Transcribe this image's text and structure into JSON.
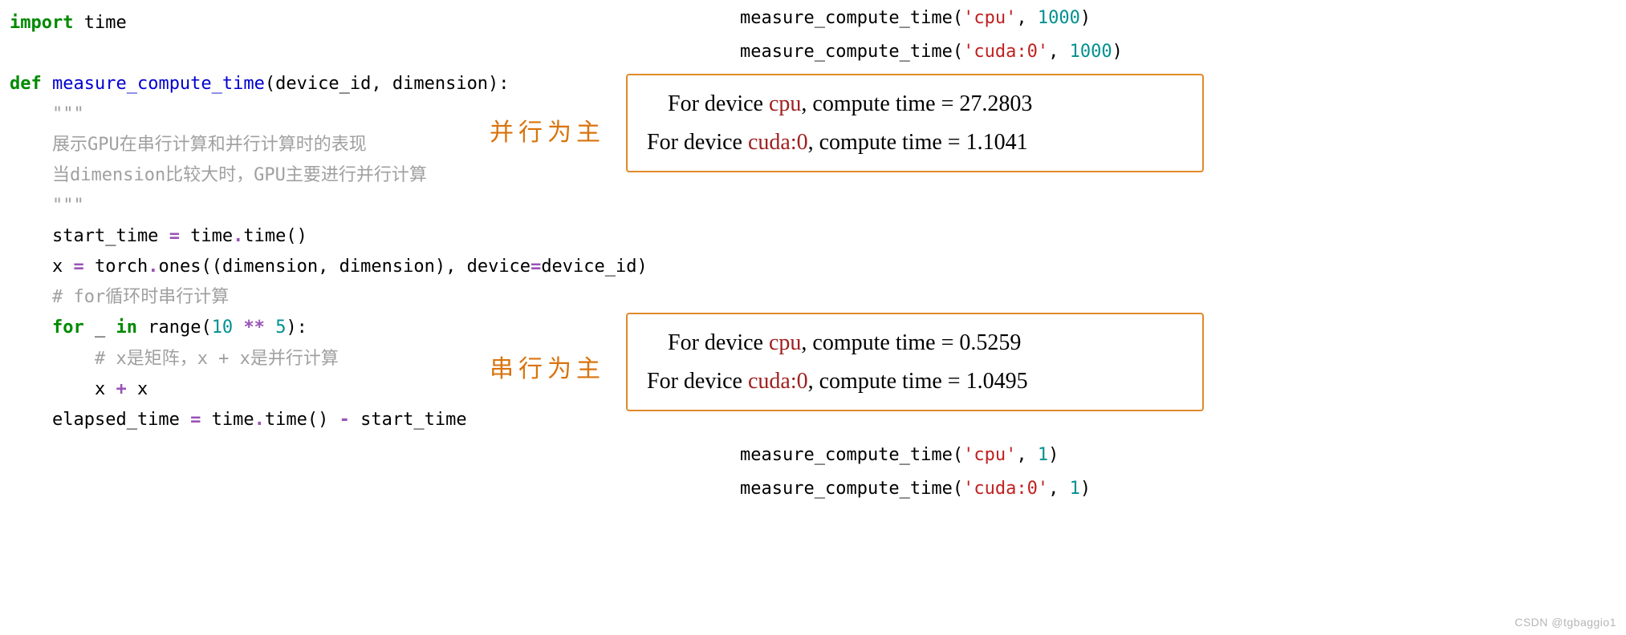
{
  "code": {
    "l1_import": "import",
    "l1_time": " time",
    "l3_def": "def",
    "l3_fn": " measure_compute_time",
    "l3_params": "(device_id, dimension):",
    "l4_triple": "    \"\"\"",
    "l5_doc1": "    展示GPU在串行计算和并行计算时的表现",
    "l6_doc2": "    当dimension比较大时，GPU主要进行并行计算",
    "l7_triple": "    \"\"\"",
    "l8_a": "    start_time ",
    "l8_op": "=",
    "l8_b": " time",
    "l8_c": ".",
    "l8_d": "time()",
    "l9_a": "    x ",
    "l9_op": "=",
    "l9_b": " torch",
    "l9_c": ".",
    "l9_d": "ones((dimension, dimension), device",
    "l9_e": "=",
    "l9_f": "device_id)",
    "l10_comment": "    # for循环时串行计算",
    "l11_for": "    for",
    "l11_b": " _ ",
    "l11_in": "in",
    "l11_c": " range(",
    "l11_n1": "10",
    "l11_d": " ",
    "l11_op": "**",
    "l11_e": " ",
    "l11_n2": "5",
    "l11_f": "):",
    "l12_comment": "        # x是矩阵，x + x是并行计算",
    "l13_a": "        x ",
    "l13_op": "+",
    "l13_b": " x",
    "l14_a": "    elapsed_time ",
    "l14_op": "=",
    "l14_b": " time",
    "l14_c": ".",
    "l14_d": "time() ",
    "l14_op2": "-",
    "l14_e": " start_time"
  },
  "calls": {
    "top1_a": "measure_compute_time(",
    "top1_s": "'cpu'",
    "top1_b": ", ",
    "top1_n": "1000",
    "top1_c": ")",
    "top2_a": "measure_compute_time(",
    "top2_s": "'cuda:0'",
    "top2_b": ", ",
    "top2_n": "1000",
    "top2_c": ")",
    "bot1_a": "measure_compute_time(",
    "bot1_s": "'cpu'",
    "bot1_b": ", ",
    "bot1_n": "1",
    "bot1_c": ")",
    "bot2_a": "measure_compute_time(",
    "bot2_s": "'cuda:0'",
    "bot2_b": ", ",
    "bot2_n": "1",
    "bot2_c": ")"
  },
  "anno": {
    "parallel": "并行为主",
    "serial": "串行为主"
  },
  "results": {
    "box1_l1_pre": "For device ",
    "box1_l1_dev": "cpu",
    "box1_l1_mid": ", compute time =  ",
    "box1_l1_val": "27.2803",
    "box1_l2_pre": "For device ",
    "box1_l2_dev": "cuda:0",
    "box1_l2_mid": ", compute time =  ",
    "box1_l2_val": "1.1041",
    "box2_l1_pre": "For device ",
    "box2_l1_dev": "cpu",
    "box2_l1_mid": ", compute time =  ",
    "box2_l1_val": "0.5259",
    "box2_l2_pre": "For device ",
    "box2_l2_dev": "cuda:0",
    "box2_l2_mid": ", compute time =  ",
    "box2_l2_val": "1.0495"
  },
  "watermark": "CSDN @tgbaggio1"
}
